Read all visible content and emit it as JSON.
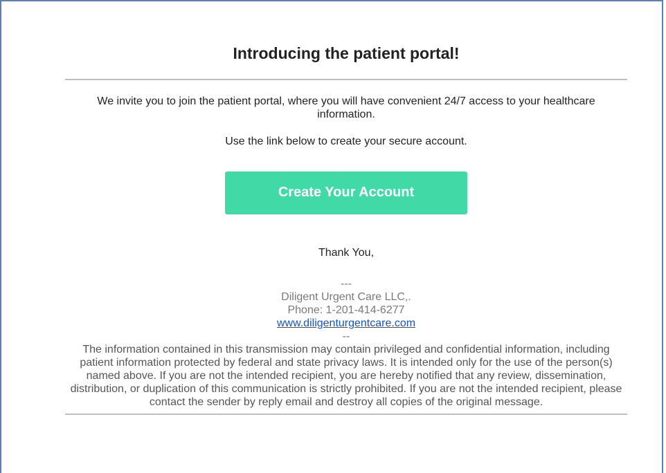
{
  "email": {
    "title": "Introducing the patient portal!",
    "intro": "We invite you to join the patient portal, where you will have convenient 24/7 access to your healthcare information.",
    "instruction": "Use the link below to create your secure account.",
    "cta_label": "Create Your Account",
    "thanks": "Thank You,",
    "signature": {
      "separator_top": "---",
      "company": "Diligent Urgent Care LLC,.",
      "phone": "Phone: 1-201-414-6277",
      "website": "www.diligenturgentcare.com",
      "separator_bottom": "--"
    },
    "disclaimer": "The information contained in this transmission may contain privileged and confidential information, including patient information protected by federal and state privacy laws. It is intended only for the use of the person(s) named above. If you are not the intended recipient, you are hereby notified that any review, dissemination, distribution, or duplication of this communication is strictly prohibited. If you are not the intended recipient, please contact the sender by reply email and destroy all copies of the original message."
  },
  "colors": {
    "button": "#41d9a5",
    "button_text": "#ffffff",
    "link": "#1155cc",
    "rule": "#bdbdbd",
    "frame_border": "#5b7fb0"
  }
}
